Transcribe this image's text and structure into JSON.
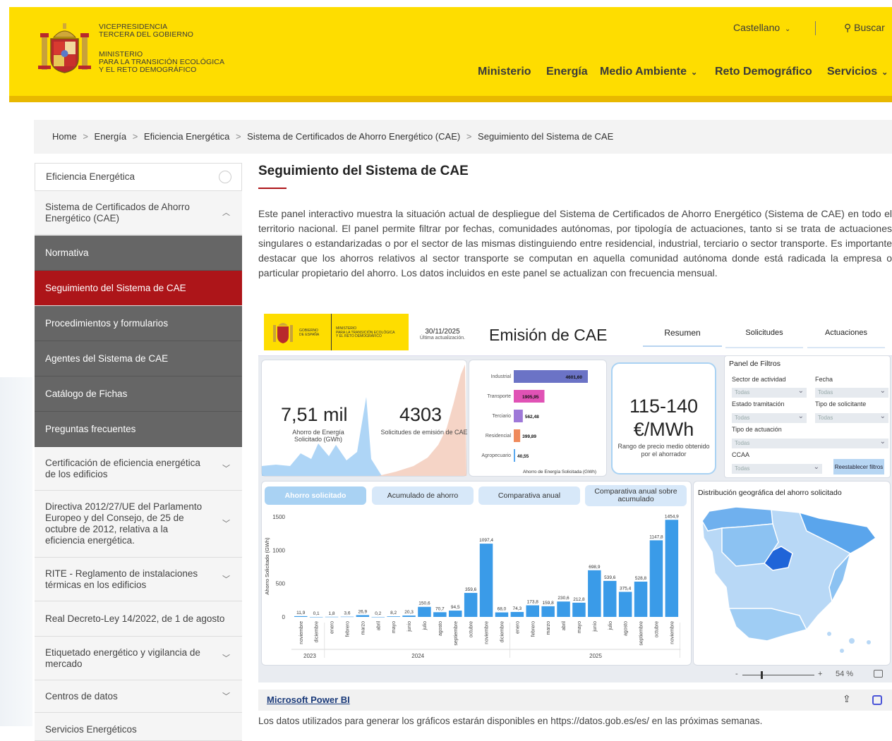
{
  "header": {
    "logo_lines": [
      "VICEPRESIDENCIA",
      "TERCERA DEL GOBIERNO",
      "MINISTERIO",
      "PARA LA TRANSICIÓN ECOLÓGICA",
      "Y EL RETO DEMOGRÁFICO"
    ],
    "language": "Castellano",
    "search": "Buscar",
    "nav": [
      "Ministerio",
      "Energía",
      "Medio Ambiente",
      "Reto Demográfico",
      "Servicios"
    ]
  },
  "breadcrumb": [
    "Home",
    "Energía",
    "Eficiencia Energética",
    "Sistema de Certificados de Ahorro Energético (CAE)",
    "Seguimiento del Sistema de CAE"
  ],
  "sidebar": {
    "items": [
      {
        "label": "Eficiencia Energética",
        "style": "light"
      },
      {
        "label": "Sistema de Certificados de Ahorro Energético (CAE)",
        "style": "light"
      },
      {
        "label": "Normativa",
        "style": "dark"
      },
      {
        "label": "Seguimiento del Sistema de CAE",
        "style": "red"
      },
      {
        "label": "Procedimientos y formularios",
        "style": "dark"
      },
      {
        "label": "Agentes del Sistema de CAE",
        "style": "dark"
      },
      {
        "label": "Catálogo de Fichas",
        "style": "dark"
      },
      {
        "label": "Preguntas frecuentes",
        "style": "dark"
      },
      {
        "label": "Certificación de eficiencia energética de los edificios",
        "style": "plain"
      },
      {
        "label": "Directiva 2012/27/UE del Parlamento Europeo y del Consejo, de 25 de octubre de 2012, relativa a la eficiencia energética.",
        "style": "plain"
      },
      {
        "label": "RITE - Reglamento de instalaciones térmicas en los edificios",
        "style": "plain"
      },
      {
        "label": "Real Decreto-Ley 14/2022, de 1 de agosto",
        "style": "plain"
      },
      {
        "label": "Etiquetado energético y vigilancia de mercado",
        "style": "plain"
      },
      {
        "label": "Centros de datos",
        "style": "plain"
      },
      {
        "label": "Servicios Energéticos",
        "style": "plain"
      }
    ]
  },
  "main": {
    "title": "Seguimiento del Sistema de CAE",
    "intro": "Este panel interactivo muestra la situación actual de despliegue del Sistema de Certificados de Ahorro Energético (Sistema de CAE) en todo el territorio nacional. El panel permite filtrar por fechas, comunidades autónomas, por tipología de actuaciones, tanto si se trata de actuaciones singulares o estandarizadas o por el sector de las mismas distinguiendo entre residencial, industrial, terciario o sector transporte. Es importante destacar que los ahorros relativos al sector transporte se computan en aquella comunidad autónoma donde está radicada la empresa o particular propietario del ahorro. Los datos incluidos en este panel se actualizan con frecuencia mensual.",
    "footnote": "Los datos utilizados para generar los gráficos estarán disponibles en https://datos.gob.es/es/ en las próximas semanas."
  },
  "dashboard": {
    "logo_left": [
      "GOBIERNO",
      "DE ESPAÑA"
    ],
    "logo_right": [
      "MINISTERIO",
      "PARA LA TRANSICIÓN ECOLÓGICA",
      "Y EL RETO DEMOGRÁFICO"
    ],
    "date": "30/11/2025",
    "date_caption": "Última actualización.",
    "title": "Emisión de CAE",
    "tabs": [
      "Resumen",
      "Solicitudes",
      "Actuaciones"
    ],
    "kpi1_value": "7,51 mil",
    "kpi1_label": "Ahorro de Energía Solicitado (GWh)",
    "kpi2_value": "4303",
    "kpi2_label": "Solicitudes de emisión de CAE",
    "price_value": "115-140 €/MWh",
    "price_label": "Rango de precio medio obtenido por el ahorrador",
    "sector_chart": {
      "xlabel": "Ahorro de Energía Solicitada (GWh)",
      "categories": [
        "Industrial",
        "Transporte",
        "Terciario",
        "Residencial",
        "Agropecuario"
      ],
      "values": [
        4601.6,
        1905.95,
        562.48,
        399.89,
        40.55
      ],
      "labels": [
        "4601,60",
        "1905,95",
        "562,48",
        "399,89",
        "40,55"
      ],
      "colors": [
        "#6b73c6",
        "#e052b5",
        "#9e78d8",
        "#ef8a5c",
        "#5aa9ef"
      ]
    },
    "filters": {
      "title": "Panel de Filtros",
      "sector_label": "Sector de actividad",
      "fecha_label": "Fecha",
      "estado_label": "Estado tramitación",
      "tipo_sol_label": "Tipo de solicitante",
      "tipo_act_label": "Tipo de actuación",
      "ccaa_label": "CCAA",
      "all": "Todas",
      "reset": "Reestablecer filtros"
    },
    "chart_buttons": [
      "Ahorro solicitado",
      "Acumulado de ahorro",
      "Comparativa anual",
      "Comparativa anual sobre acumulado"
    ],
    "map_title": "Distribución geográfica del ahorro solicitado",
    "zoom": "54 %",
    "powerbi": "Microsoft Power BI"
  },
  "chart_data": {
    "type": "bar",
    "ylabel": "Ahorro Solicitado (GWh)",
    "ylim": [
      0,
      1500
    ],
    "yticks": [
      0,
      500,
      1000,
      1500
    ],
    "categories": [
      "noviembre",
      "diciembre",
      "enero",
      "febrero",
      "marzo",
      "abril",
      "mayo",
      "junio",
      "julio",
      "agosto",
      "septiembre",
      "octubre",
      "noviembre",
      "diciembre",
      "enero",
      "febrero",
      "marzo",
      "abril",
      "mayo",
      "junio",
      "julio",
      "agosto",
      "septiembre",
      "octubre",
      "noviembre"
    ],
    "values": [
      11.9,
      0.1,
      1.8,
      3.6,
      26.9,
      0.2,
      8.2,
      20.3,
      150.6,
      70.7,
      94.5,
      359.6,
      1097.4,
      68.0,
      74.3,
      173.8,
      159.8,
      230.6,
      212.8,
      698.9,
      539.6,
      375.4,
      528.8,
      1147.8,
      1454.9
    ],
    "value_labels": [
      "11,9",
      "0,1",
      "1,8",
      "3,6",
      "26,9",
      "0,2",
      "8,2",
      "20,3",
      "150,6",
      "70,7",
      "94,5",
      "359,6",
      "1097,4",
      "68,0",
      "74,3",
      "173,8",
      "159,8",
      "230,6",
      "212,8",
      "698,9",
      "539,6",
      "375,4",
      "528,8",
      "1147,8",
      "1454,9"
    ],
    "years": [
      {
        "label": "2023",
        "start": 0,
        "end": 1
      },
      {
        "label": "2024",
        "start": 2,
        "end": 13
      },
      {
        "label": "2025",
        "start": 14,
        "end": 24
      }
    ],
    "color": "#3a9be8"
  }
}
